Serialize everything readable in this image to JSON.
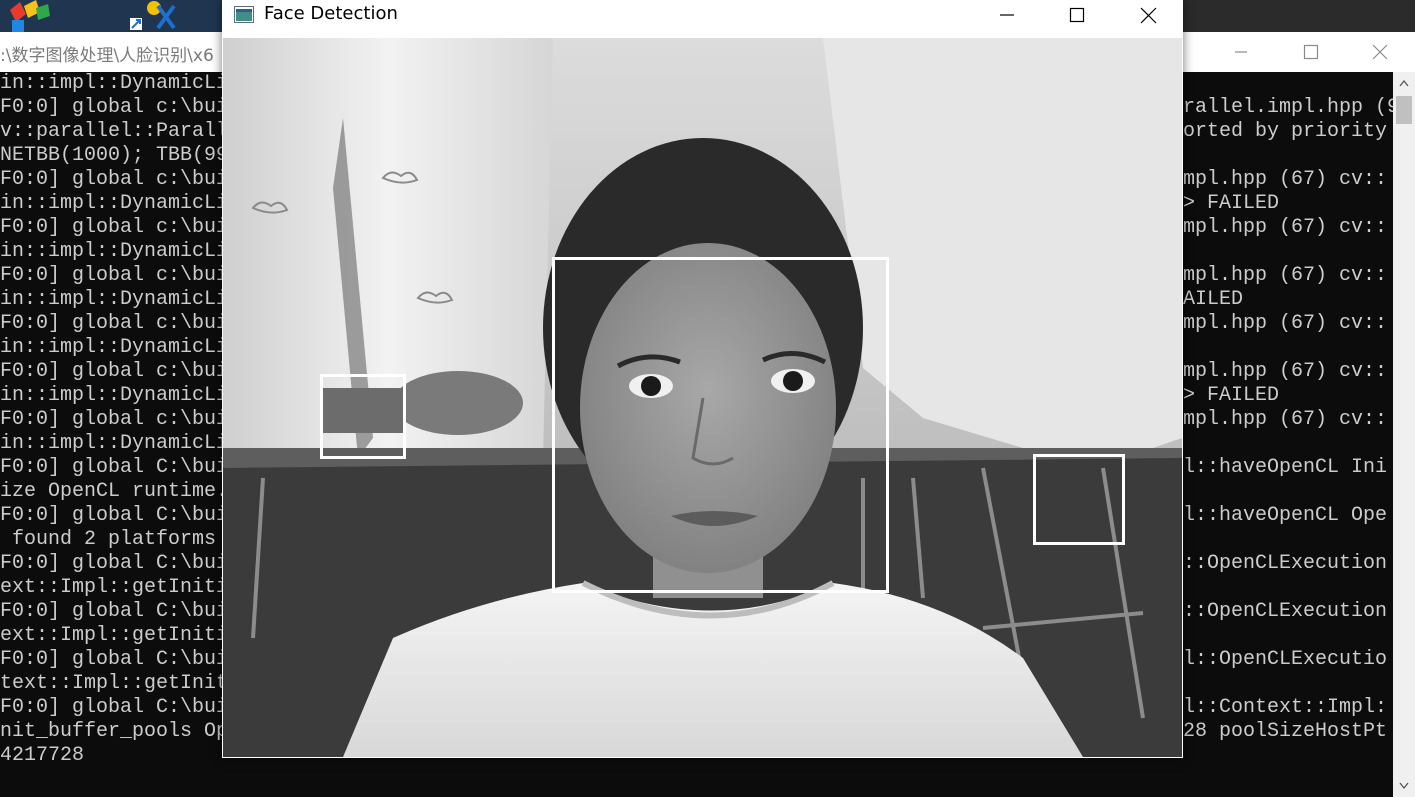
{
  "colors": {
    "console_bg": "#0c0c0c",
    "console_text": "#cccccc",
    "detection_box": "#ffffff",
    "titlebar_bg": "#ffffff"
  },
  "desktop": {
    "icons": [
      "app-icon",
      "tools-shortcut-icon"
    ]
  },
  "console": {
    "title": ":\\数字图像处理\\人脸识别\\x6",
    "controls": [
      "minimize-icon",
      "maximize-icon",
      "close-icon"
    ],
    "left_lines": [
      "in::impl::DynamicLi",
      "F0:0] global c:\\bui",
      "v::parallel::Parall",
      "NETBB(1000); TBB(99",
      "F0:0] global c:\\bui",
      "in::impl::DynamicLi",
      "F0:0] global c:\\bui",
      "in::impl::DynamicLi",
      "F0:0] global c:\\bui",
      "in::impl::DynamicLi",
      "F0:0] global c:\\bui",
      "in::impl::DynamicLi",
      "F0:0] global c:\\bui",
      "in::impl::DynamicLi",
      "F0:0] global c:\\bui",
      "in::impl::DynamicLi",
      "F0:0] global C:\\bui",
      "ize OpenCL runtime.",
      "F0:0] global C:\\bui",
      " found 2 platforms",
      "F0:0] global C:\\bui",
      "ext::Impl::getIniti",
      "F0:0] global C:\\bui",
      "ext::Impl::getIniti",
      "F0:0] global C:\\bui",
      "text::Impl::getInit",
      "F0:0] global C:\\bui",
      "nit_buffer_pools Op",
      "4217728"
    ],
    "right_lines": [
      {
        "row": 1,
        "text": "rallel.impl.hpp (9"
      },
      {
        "row": 2,
        "text": "orted by priority"
      },
      {
        "row": 4,
        "text": "mpl.hpp (67) cv::"
      },
      {
        "row": 5,
        "text": "> FAILED"
      },
      {
        "row": 6,
        "text": "mpl.hpp (67) cv::"
      },
      {
        "row": 8,
        "text": "mpl.hpp (67) cv::"
      },
      {
        "row": 9,
        "text": "AILED"
      },
      {
        "row": 10,
        "text": "mpl.hpp (67) cv::"
      },
      {
        "row": 12,
        "text": "mpl.hpp (67) cv::"
      },
      {
        "row": 13,
        "text": "> FAILED"
      },
      {
        "row": 14,
        "text": "mpl.hpp (67) cv::"
      },
      {
        "row": 16,
        "text": "l::haveOpenCL Ini"
      },
      {
        "row": 18,
        "text": "l::haveOpenCL Ope"
      },
      {
        "row": 20,
        "text": "::OpenCLExecution"
      },
      {
        "row": 22,
        "text": "::OpenCLExecution"
      },
      {
        "row": 24,
        "text": "l::OpenCLExecutio"
      },
      {
        "row": 26,
        "text": "l::Context::Impl:"
      },
      {
        "row": 27,
        "text": "28 poolSizeHostPt"
      }
    ]
  },
  "face_window": {
    "title": "Face Detection",
    "controls": [
      "minimize-icon",
      "maximize-icon",
      "close-icon"
    ],
    "frame": "grayscale webcam frame",
    "detections_count": 3
  }
}
